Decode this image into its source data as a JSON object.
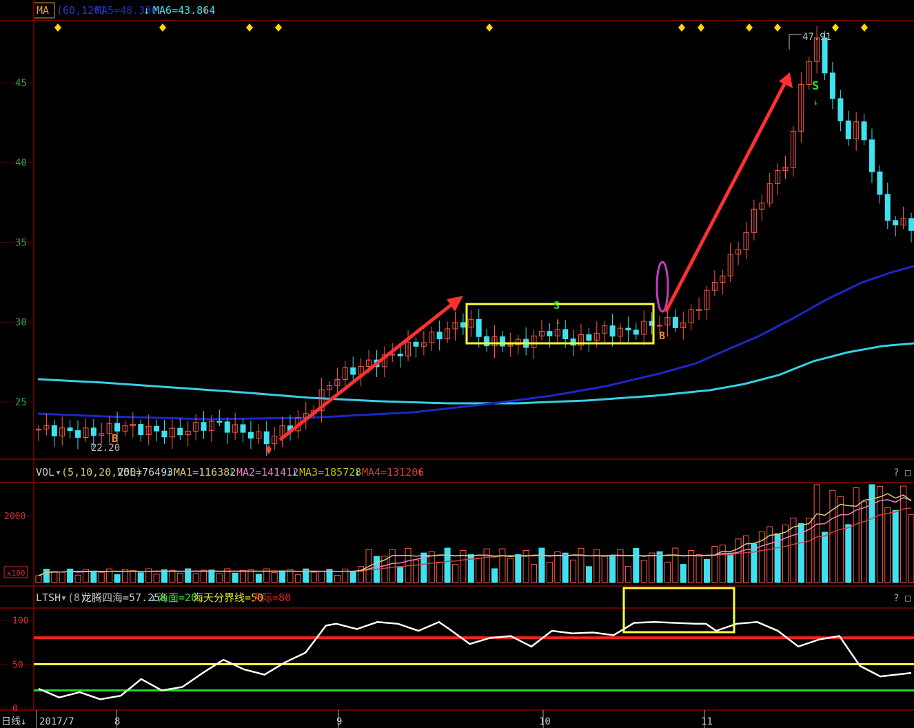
{
  "colors": {
    "background": "#000000",
    "grid": "#8b0000",
    "price_axis_label": "#1faa3a",
    "candle_up": "#ff5a46",
    "candle_down": "#40e0f0",
    "ma_blue": "#1c28c8",
    "ma_cyan": "#35d0e8",
    "arrow": "#ff3030",
    "highlight_box": "#ffff30",
    "ring": "#c040c0",
    "vol_line_yellow": "#d8c878",
    "vol_line_pink": "#f080c0",
    "vol_line_red": "#d04040",
    "ltsh_line": "#ffffff",
    "ltsh_red_line": "#ff2020",
    "ltsh_yellow_line": "#ffff40",
    "ltsh_green_line": "#20e020",
    "signal_diamond": "#ffd700",
    "signal_b": "#ff8020",
    "signal_s": "#30e030"
  },
  "top_legend": {
    "indicator": "MA",
    "params": "(60,120)",
    "ma5": "MA5=48.330",
    "ma6": "MA6=43.864"
  },
  "vol_legend": {
    "indicator": "VOL",
    "params": "(5,10,20,250)",
    "vol": "VOL=76493",
    "ma1": "MA1=116382",
    "ma2": "MA2=141412",
    "ma3": "MA3=185728",
    "ma4": "MA4=131206"
  },
  "ltsh_legend": {
    "indicator": "LTSH",
    "params": "(8)",
    "value": "龙腾四海=57.258",
    "sea": "海面=20",
    "boundary": "海天分界线=50",
    "sky": "天际=80"
  },
  "panel_icons": "? □ ×",
  "time_axis": {
    "period_button": "日线",
    "labels": [
      "2017/7",
      "8",
      "9",
      "10",
      "11"
    ]
  },
  "annotations": {
    "high_label": "47.91",
    "low_label": "22.20",
    "b_signal": "B",
    "s_signal": "S"
  },
  "chart_data": [
    {
      "type": "candlestick",
      "title": "",
      "ylabel": "",
      "ylim": [
        21.5,
        48.8
      ],
      "yticks": [
        25,
        30,
        35,
        40,
        45
      ],
      "series": [
        {
          "name": "MA(60)",
          "values_start_end": [
            24.1,
            33.5
          ]
        },
        {
          "name": "MA(120)",
          "values_start_end": [
            26.4,
            28.5
          ]
        }
      ],
      "high": 47.91,
      "low": 22.2
    },
    {
      "type": "bar",
      "title": "",
      "ylabel": "",
      "yticks": [
        2000
      ]
    },
    {
      "type": "line",
      "title": "",
      "ylabel": "",
      "ylim": [
        0,
        110
      ],
      "yticks": [
        0,
        50,
        100
      ],
      "reference_lines": [
        80,
        50,
        20
      ]
    }
  ]
}
